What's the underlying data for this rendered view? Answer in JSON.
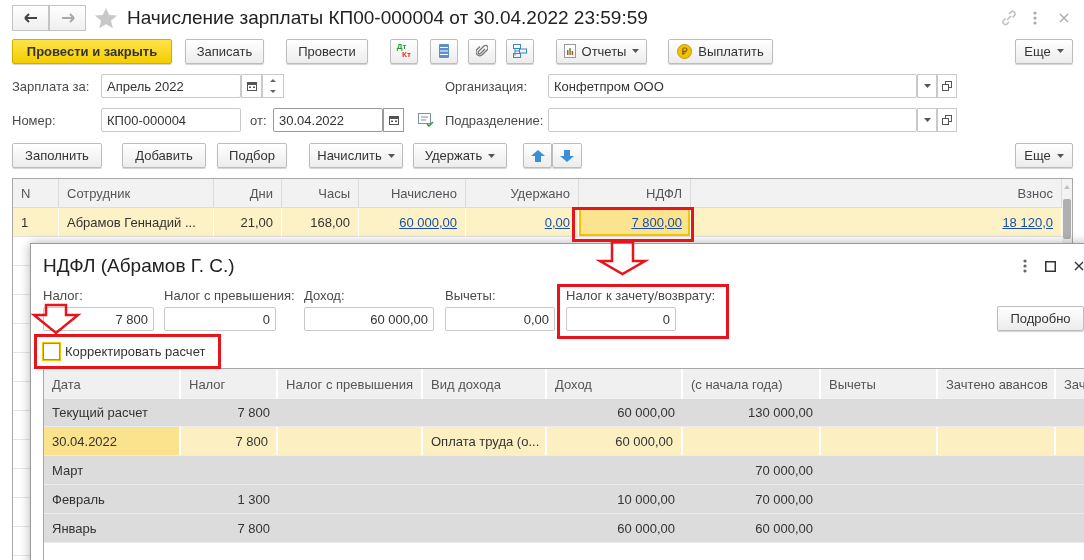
{
  "window": {
    "title": "Начисление зарплаты КП00-000004 от 30.04.2022 23:59:59"
  },
  "nav": [
    {
      "kind": "back",
      "disabled": false
    },
    {
      "kind": "forward",
      "disabled": true
    }
  ],
  "toolbar": {
    "buttons": [
      {
        "label": "Провести и закрыть",
        "primary": true
      },
      {
        "label": "Записать",
        "primary": false
      },
      {
        "label": "Провести",
        "primary": false
      }
    ],
    "dtkt": {
      "debit": "Дт",
      "credit": "Кт"
    },
    "reports": "Отчеты",
    "pay": "Выплатить",
    "more": "Еще"
  },
  "header": {
    "period": {
      "label": "Зарплата за:",
      "value": "Апрель 2022"
    },
    "organization": {
      "label": "Организация:",
      "value": "Конфетпром ООО"
    },
    "number": {
      "label": "Номер:",
      "value": "КП00-000004"
    },
    "date": {
      "label": "от:",
      "value": "30.04.2022"
    },
    "department": {
      "label": "Подразделение:"
    }
  },
  "table_toolbar": {
    "buttons": [
      {
        "label": "Заполнить",
        "dropdown": false
      },
      {
        "label": "Добавить",
        "dropdown": false
      },
      {
        "label": "Подбор",
        "dropdown": false
      },
      {
        "label": "Начислить",
        "dropdown": true
      },
      {
        "label": "Удержать",
        "dropdown": true
      }
    ],
    "more": "Еще"
  },
  "employees": {
    "columns": [
      "N",
      "Сотрудник",
      "Дни",
      "Часы",
      "Начислено",
      "Удержано",
      "НДФЛ",
      "Взнос"
    ],
    "rows": [
      {
        "selected": true,
        "cells": [
          {
            "text": "1",
            "link": false,
            "current": false
          },
          {
            "text": "Абрамов Геннадий ...",
            "link": false,
            "current": false
          },
          {
            "text": "21,00",
            "link": false,
            "current": false
          },
          {
            "text": "168,00",
            "link": false,
            "current": false
          },
          {
            "text": "60 000,00",
            "link": true,
            "current": false
          },
          {
            "text": "0,00",
            "link": true,
            "current": false
          },
          {
            "text": "7 800,00",
            "link": true,
            "current": true
          },
          {
            "text": "18 120,0",
            "link": true,
            "current": false
          }
        ]
      }
    ]
  },
  "dialog": {
    "title": "НДФЛ (Абрамов Г. С.)",
    "fields": [
      {
        "label": "Налог:",
        "value": "7 800"
      },
      {
        "label": "Налог с превышения:",
        "value": "0"
      },
      {
        "label": "Доход:",
        "value": "60 000,00"
      },
      {
        "label": "Вычеты:",
        "value": "0,00"
      },
      {
        "label": "Налог к зачету/возврату:",
        "value": "0"
      }
    ],
    "details_button": "Подробно",
    "checkbox": {
      "label": "Корректировать расчет",
      "checked": false
    },
    "table": {
      "columns": [
        "Дата",
        "Налог",
        "Налог с превышения",
        "Вид дохода",
        "Доход",
        "(с начала года)",
        "Вычеты",
        "Зачтено авансов",
        "Зач"
      ],
      "rows": [
        {
          "kind": "group",
          "selected": false,
          "date": "Текущий расчет",
          "tax": "7 800",
          "income": "60 000,00",
          "ytd": "130 000,00"
        },
        {
          "kind": "entry",
          "selected": true,
          "date": "30.04.2022",
          "tax": "7 800",
          "income_type": "Оплата труда (о...",
          "income": "60 000,00"
        },
        {
          "kind": "group",
          "selected": false,
          "date": "Март",
          "ytd": "70 000,00"
        },
        {
          "kind": "group",
          "selected": false,
          "date": "Февраль",
          "tax": "1 300",
          "income": "10 000,00",
          "ytd": "70 000,00"
        },
        {
          "kind": "group",
          "selected": false,
          "date": "Январь",
          "tax": "7 800",
          "income": "60 000,00",
          "ytd": "60 000,00"
        }
      ]
    }
  }
}
